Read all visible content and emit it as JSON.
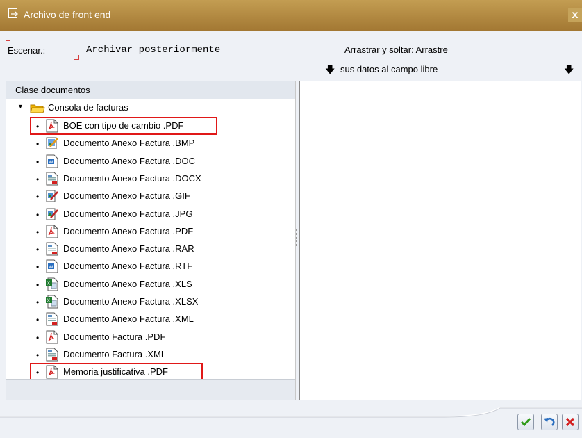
{
  "window": {
    "title": "Archivo de front end",
    "close_label": "x"
  },
  "toolbar": {
    "scan_label": "Escenar.:",
    "archive_later_label": "Archivar posteriormente",
    "drag_drop_hint_1": "Arrastrar y soltar: Arrastre",
    "drag_drop_hint_2": "sus datos al campo libre"
  },
  "tree": {
    "header": "Clase documentos",
    "root_label": "Consola de facturas",
    "items": [
      {
        "label": "BOE con tipo de cambio .PDF",
        "icon": "pdf-icon",
        "highlighted": true
      },
      {
        "label": "Documento Anexo Factura .BMP",
        "icon": "bmp-image-icon",
        "highlighted": false
      },
      {
        "label": "Documento Anexo Factura .DOC",
        "icon": "word-doc-icon",
        "highlighted": false
      },
      {
        "label": "Documento Anexo Factura .DOCX",
        "icon": "generic-doc-icon",
        "highlighted": false
      },
      {
        "label": "Documento Anexo Factura .GIF",
        "icon": "image-edit-icon",
        "highlighted": false
      },
      {
        "label": "Documento Anexo Factura .JPG",
        "icon": "image-edit-icon",
        "highlighted": false
      },
      {
        "label": "Documento Anexo Factura .PDF",
        "icon": "pdf-icon",
        "highlighted": false
      },
      {
        "label": "Documento Anexo Factura .RAR",
        "icon": "generic-doc-icon",
        "highlighted": false
      },
      {
        "label": "Documento Anexo Factura .RTF",
        "icon": "word-doc-icon",
        "highlighted": false
      },
      {
        "label": "Documento Anexo Factura .XLS",
        "icon": "excel-doc-icon",
        "highlighted": false
      },
      {
        "label": "Documento Anexo Factura .XLSX",
        "icon": "excel-doc-icon",
        "highlighted": false
      },
      {
        "label": "Documento Anexo Factura .XML",
        "icon": "generic-doc-icon",
        "highlighted": false
      },
      {
        "label": "Documento Factura .PDF",
        "icon": "pdf-icon",
        "highlighted": false
      },
      {
        "label": "Documento Factura .XML",
        "icon": "generic-doc-icon",
        "highlighted": false
      },
      {
        "label": "Memoria justificativa .PDF",
        "icon": "pdf-icon",
        "highlighted": true
      }
    ]
  },
  "colors": {
    "titlebar": "#b48a43",
    "highlight": "#e01818",
    "ok": "#2f9a1a",
    "cancel": "#d42020",
    "undo": "#2a6fc0"
  }
}
